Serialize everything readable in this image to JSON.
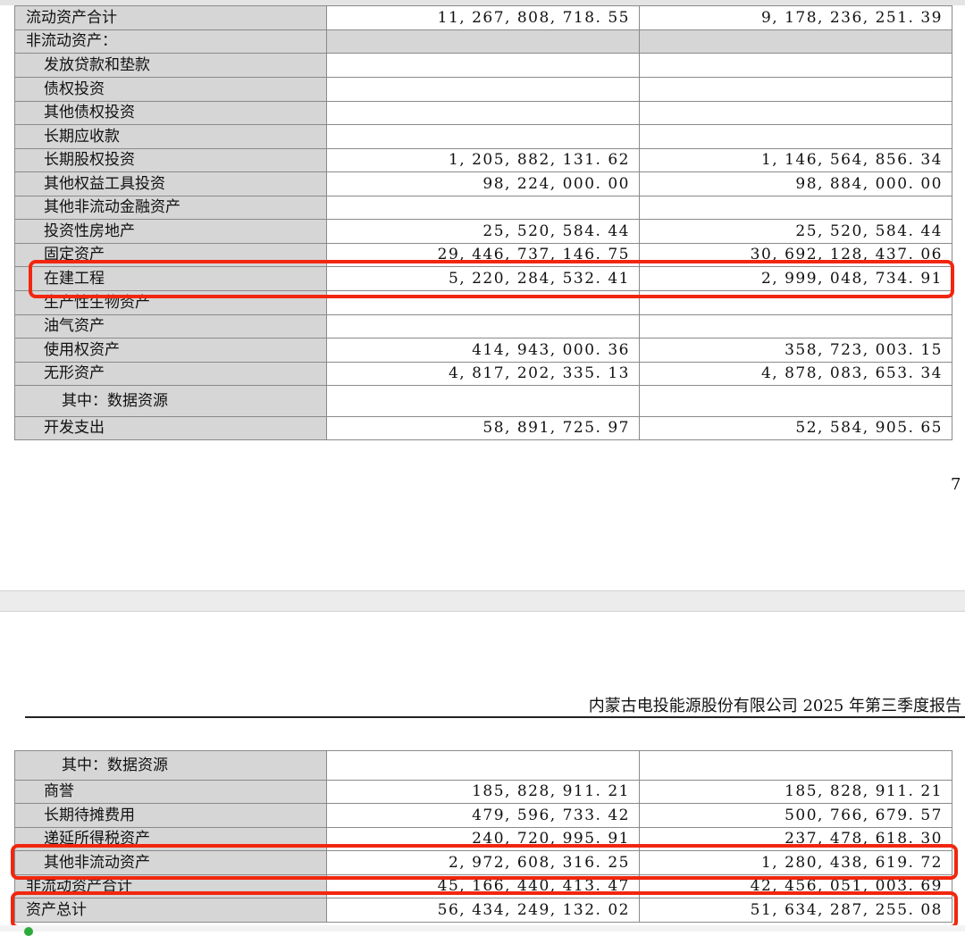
{
  "table_top": {
    "rows": [
      {
        "label": "流动资产合计",
        "current": "11, 267, 808, 718. 55",
        "previous": "9, 178, 236, 251. 39",
        "indent": 0
      },
      {
        "label": "非流动资产：",
        "current": "",
        "previous": "",
        "indent": 0,
        "section": true
      },
      {
        "label": "发放贷款和垫款",
        "current": "",
        "previous": "",
        "indent": 1
      },
      {
        "label": "债权投资",
        "current": "",
        "previous": "",
        "indent": 1
      },
      {
        "label": "其他债权投资",
        "current": "",
        "previous": "",
        "indent": 1
      },
      {
        "label": "长期应收款",
        "current": "",
        "previous": "",
        "indent": 1
      },
      {
        "label": "长期股权投资",
        "current": "1, 205, 882, 131. 62",
        "previous": "1, 146, 564, 856. 34",
        "indent": 1
      },
      {
        "label": "其他权益工具投资",
        "current": "98, 224, 000. 00",
        "previous": "98, 884, 000. 00",
        "indent": 1
      },
      {
        "label": "其他非流动金融资产",
        "current": "",
        "previous": "",
        "indent": 1
      },
      {
        "label": "投资性房地产",
        "current": "25, 520, 584. 44",
        "previous": "25, 520, 584. 44",
        "indent": 1
      },
      {
        "label": "固定资产",
        "current": "29, 446, 737, 146. 75",
        "previous": "30, 692, 128, 437. 06",
        "indent": 1
      },
      {
        "label": "在建工程",
        "current": "5, 220, 284, 532. 41",
        "previous": "2, 999, 048, 734. 91",
        "indent": 1,
        "highlighted": true
      },
      {
        "label": "生产性生物资产",
        "current": "",
        "previous": "",
        "indent": 1
      },
      {
        "label": "油气资产",
        "current": "",
        "previous": "",
        "indent": 1
      },
      {
        "label": "使用权资产",
        "current": "414, 943, 000. 36",
        "previous": "358, 723, 003. 15",
        "indent": 1
      },
      {
        "label": "无形资产",
        "current": "4, 817, 202, 335. 13",
        "previous": "4, 878, 083, 653. 34",
        "indent": 1
      },
      {
        "label": "其中：数据资源",
        "current": "",
        "previous": "",
        "indent": 2,
        "tall": true
      },
      {
        "label": "开发支出",
        "current": "58, 891, 725. 97",
        "previous": "52, 584, 905. 65",
        "indent": 1
      }
    ]
  },
  "page_number": "7",
  "running_header": "内蒙古电投能源股份有限公司 2025 年第三季度报告",
  "table_bottom": {
    "rows": [
      {
        "label": "其中：数据资源",
        "current": "",
        "previous": "",
        "indent": 2,
        "tall": true
      },
      {
        "label": "商誉",
        "current": "185, 828, 911. 21",
        "previous": "185, 828, 911. 21",
        "indent": 1
      },
      {
        "label": "长期待摊费用",
        "current": "479, 596, 733. 42",
        "previous": "500, 766, 679. 57",
        "indent": 1
      },
      {
        "label": "递延所得税资产",
        "current": "240, 720, 995. 91",
        "previous": "237, 478, 618. 30",
        "indent": 1
      },
      {
        "label": "其他非流动资产",
        "current": "2, 972, 608, 316. 25",
        "previous": "1, 280, 438, 619. 72",
        "indent": 1,
        "highlighted": true
      },
      {
        "label": "非流动资产合计",
        "current": "45, 166, 440, 413. 47",
        "previous": "42, 456, 051, 003. 69",
        "indent": 0
      },
      {
        "label": "资产总计",
        "current": "56, 434, 249, 132. 02",
        "previous": "51, 634, 287, 255. 08",
        "indent": 0,
        "highlighted": true
      }
    ]
  },
  "colors": {
    "highlight": "#f2260e",
    "label_cell": "#d6d6d6",
    "border": "#8a8a8a"
  }
}
